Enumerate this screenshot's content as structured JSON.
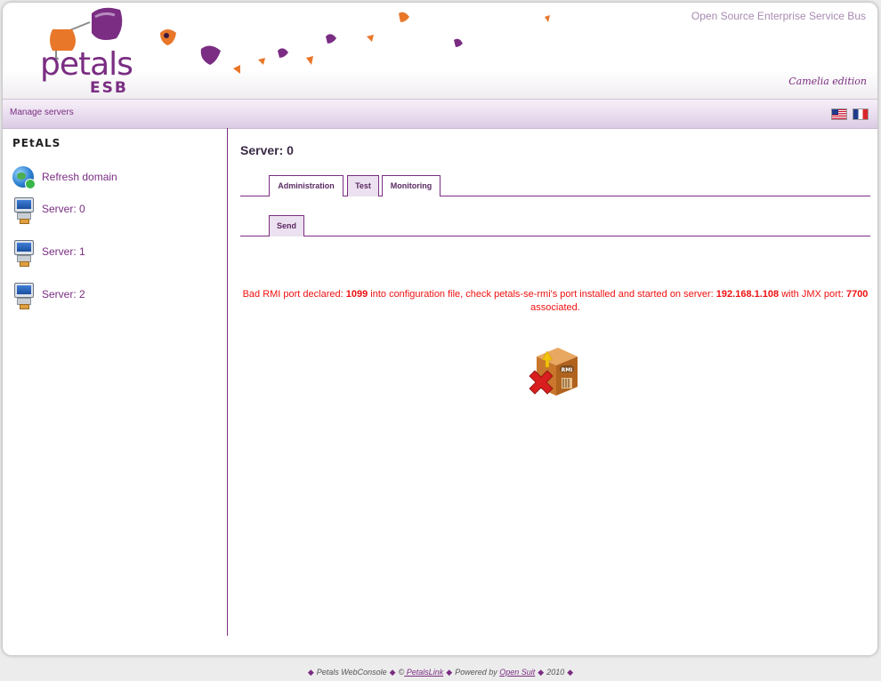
{
  "header": {
    "logo_text": "petals",
    "logo_sub": "ESB",
    "tagline": "Open Source Enterprise Service Bus",
    "edition": "Camelia edition"
  },
  "menubar": {
    "manage_servers": "Manage servers",
    "languages": [
      "us-flag-icon",
      "fr-flag-icon"
    ]
  },
  "sidebar": {
    "title": "PEtALS",
    "items": [
      {
        "label": "Refresh domain",
        "icon": "globe-refresh-icon"
      },
      {
        "label": "Server: 0",
        "icon": "computer-icon"
      },
      {
        "label": "Server: 1",
        "icon": "computer-icon"
      },
      {
        "label": "Server: 2",
        "icon": "computer-icon"
      }
    ]
  },
  "main": {
    "title": "Server: 0",
    "tabs": [
      "Administration",
      "Test",
      "Monitoring"
    ],
    "active_tab": "Test",
    "subtabs": [
      "Send"
    ],
    "error": {
      "part1": "Bad RMI port declared: ",
      "port": "1099",
      "part2": " into configuration file, check petals-se-rmi's port installed and started on server: ",
      "server": "192.168.1.108",
      "part3": " with JMX port: ",
      "jmx_port": "7700",
      "part4": " associated."
    },
    "icon": "rmi-error-icon",
    "icon_label": "RMI"
  },
  "footer": {
    "app": "Petals WebConsole",
    "copyright": "©",
    "company": " PetalsLink",
    "powered": "Powered by",
    "powered_link": "Open Suit",
    "year": "2010"
  },
  "colors": {
    "accent": "#7a2d82",
    "error": "#ee1111",
    "orange": "#e8772a"
  }
}
